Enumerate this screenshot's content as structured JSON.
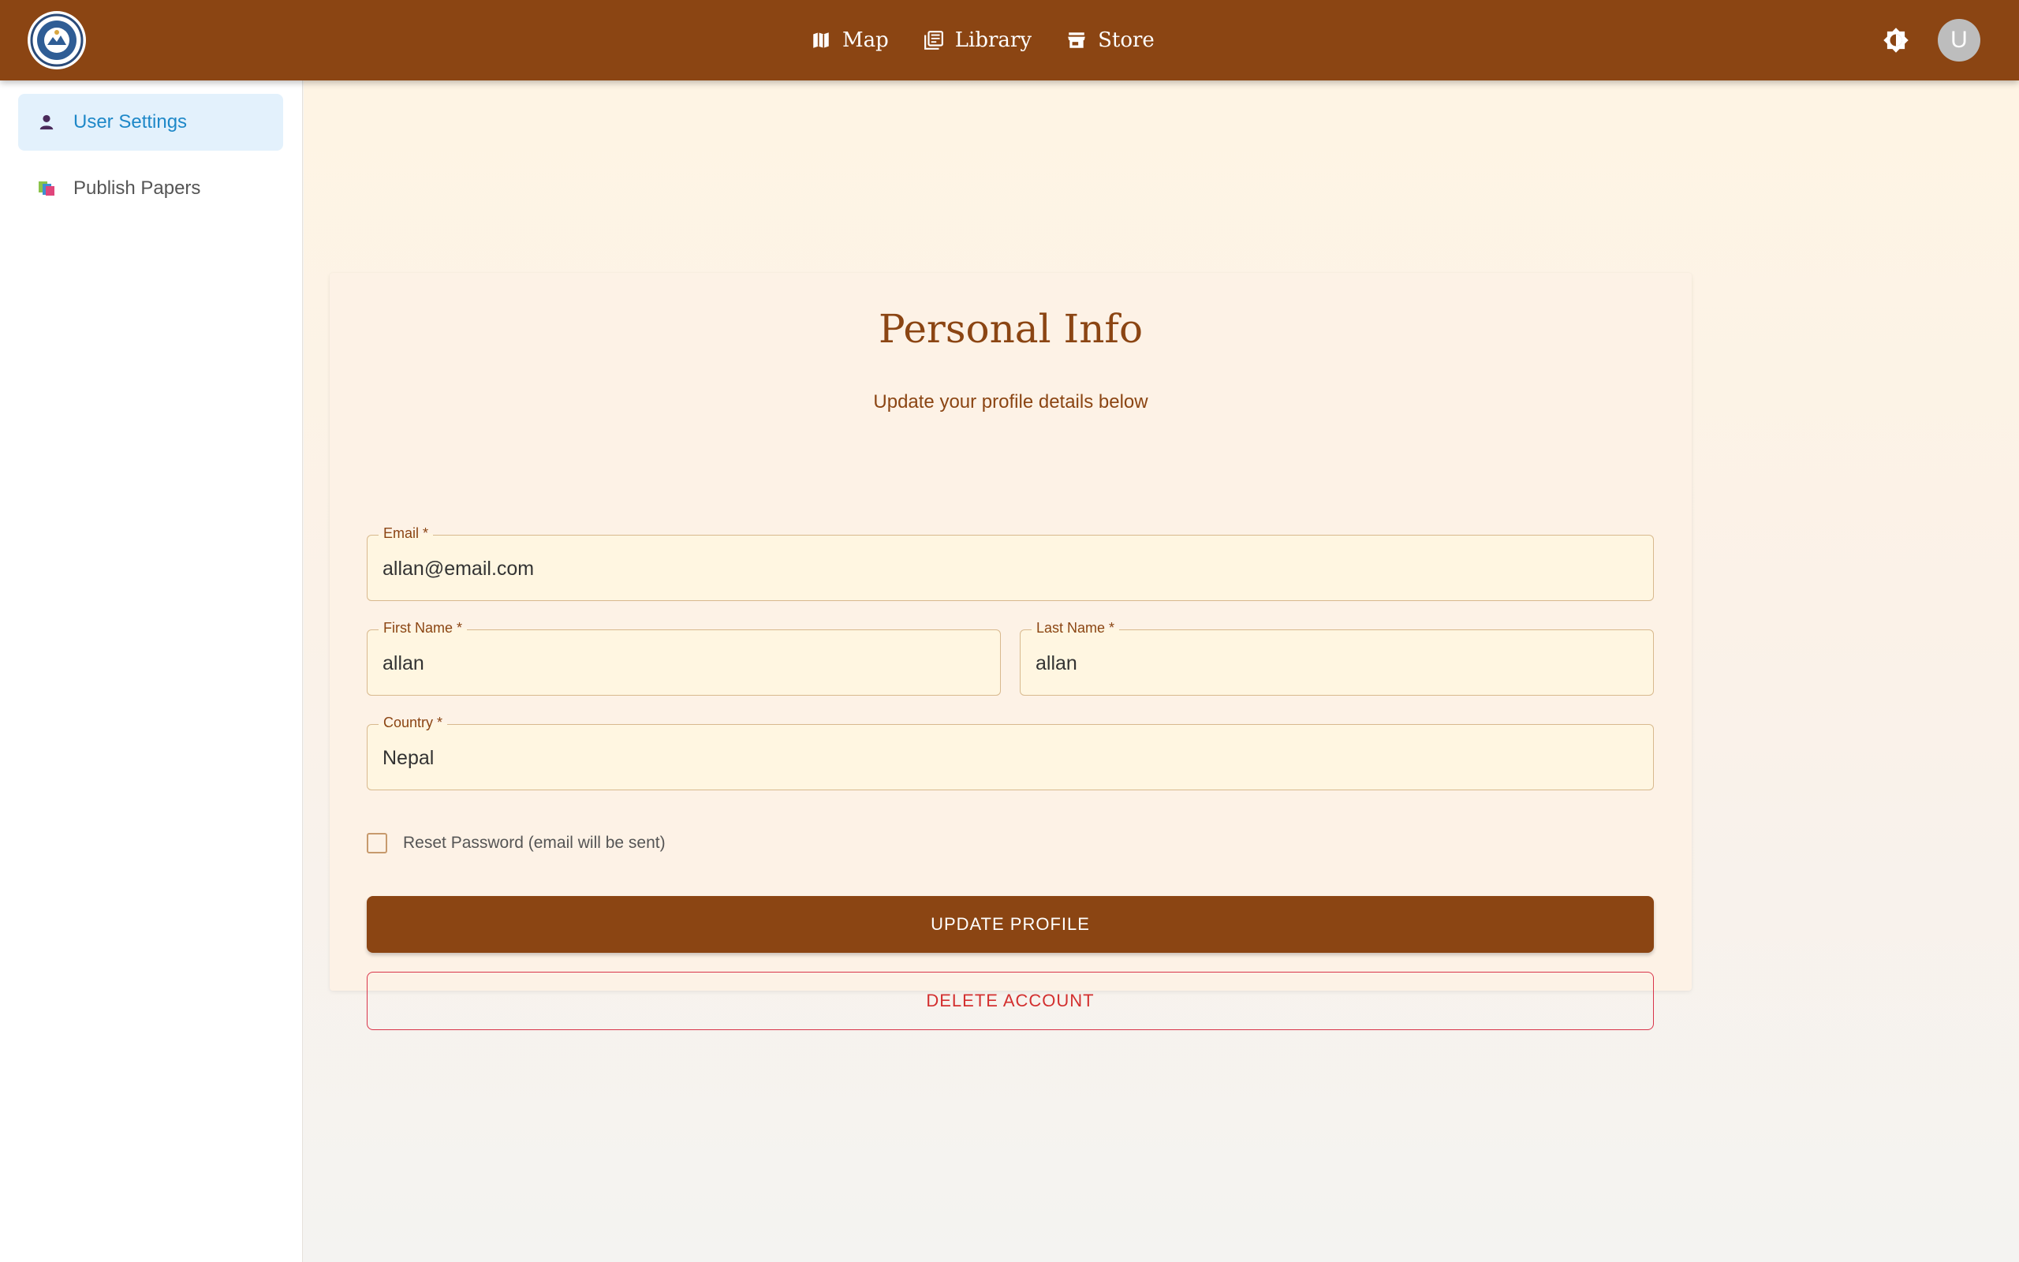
{
  "topbar": {
    "nav": [
      {
        "label": "Map",
        "icon": "map-icon"
      },
      {
        "label": "Library",
        "icon": "library-icon"
      },
      {
        "label": "Store",
        "icon": "store-icon"
      }
    ],
    "avatar_initial": "U",
    "brand_color": "#8b4513"
  },
  "sidebar": {
    "items": [
      {
        "label": "User Settings",
        "icon": "user-icon",
        "active": true
      },
      {
        "label": "Publish Papers",
        "icon": "papers-icon",
        "active": false
      }
    ]
  },
  "card": {
    "title": "Personal Info",
    "subtitle": "Update your profile details below",
    "fields": {
      "email": {
        "label": "Email *",
        "value": "allan@email.com"
      },
      "first_name": {
        "label": "First Name *",
        "value": "allan"
      },
      "last_name": {
        "label": "Last Name *",
        "value": "allan"
      },
      "country": {
        "label": "Country *",
        "value": "Nepal"
      }
    },
    "reset_password_label": "Reset Password (email will be sent)",
    "update_button": "UPDATE PROFILE",
    "delete_button": "DELETE ACCOUNT",
    "danger_color": "#d32f2f"
  }
}
